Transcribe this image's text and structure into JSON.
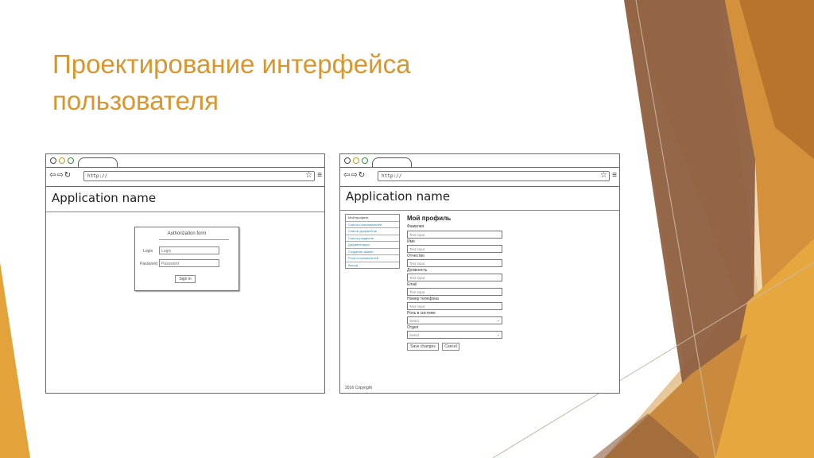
{
  "slide": {
    "title_line1": "Проектирование интерфейса",
    "title_line2": "пользователя",
    "accent_color": "#d9962c"
  },
  "browser": {
    "url_text": "http://",
    "nav_icons": [
      "back-arrow-icon",
      "forward-arrow-icon",
      "reload-icon"
    ],
    "star_icon": "star-icon",
    "menu_icon": "hamburger-icon"
  },
  "mock_login": {
    "app_name": "Application name",
    "form_title": "Authorization form",
    "login_label": "Login",
    "login_placeholder": "Login",
    "password_label": "Password",
    "password_placeholder": "Password",
    "sign_in_label": "Sign in"
  },
  "mock_profile": {
    "app_name": "Application name",
    "nav_items": [
      "Мой профиль",
      "Список пользователей",
      "Список документов",
      "Список разделов",
      "Документация",
      "Создание заявки",
      "Роли пользователей",
      "Выход"
    ],
    "form_title": "Мой профиль",
    "fields": [
      {
        "label": "Фамилия",
        "placeholder": "Text input"
      },
      {
        "label": "Имя",
        "placeholder": "Text input"
      },
      {
        "label": "Отчество",
        "placeholder": "Text input"
      },
      {
        "label": "Должность",
        "placeholder": "Text input"
      },
      {
        "label": "Email",
        "placeholder": "Text input"
      },
      {
        "label": "Номер телефона",
        "placeholder": "Text input"
      }
    ],
    "selects": [
      {
        "label": "Роль в системе",
        "value": "Select"
      },
      {
        "label": "Отдел",
        "value": "Select"
      }
    ],
    "save_label": "Save changes",
    "cancel_label": "Cancel",
    "copyright": "2016 Copyright"
  }
}
